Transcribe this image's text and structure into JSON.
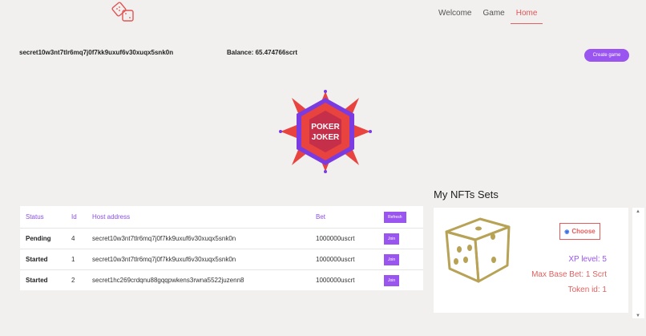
{
  "nav": {
    "tabs": [
      {
        "label": "Welcome"
      },
      {
        "label": "Game"
      },
      {
        "label": "Home"
      }
    ],
    "active": "Home"
  },
  "account": {
    "address": "secret10w3nt7tlr6mq7j0f7kk9uxuf6v30xuqx5snk0n",
    "balance": "Balance: 65.474766scrt"
  },
  "actions": {
    "create_game": "Create game",
    "refresh": "Refresh",
    "join": "Join"
  },
  "banner": {
    "line1": "POKER",
    "line2": "JOKER"
  },
  "games_table": {
    "columns": [
      "Status",
      "Id",
      "Host address",
      "Bet"
    ],
    "rows": [
      {
        "status": "Pending",
        "id": "4",
        "host": "secret10w3nt7tlr6mq7j0f7kk9uxuf6v30xuqx5snk0n",
        "bet": "1000000uscrt"
      },
      {
        "status": "Started",
        "id": "1",
        "host": "secret10w3nt7tlr6mq7j0f7kk9uxuf6v30xuqx5snk0n",
        "bet": "1000000uscrt"
      },
      {
        "status": "Started",
        "id": "2",
        "host": "secret1hc269crdqnu88gqqpwkens3rwna5522juzenn8",
        "bet": "1000000uscrt"
      }
    ]
  },
  "nfts": {
    "title": "My NFTs Sets",
    "choose_label": "Choose",
    "xp": "XP level: 5",
    "max_bet": "Max Base Bet: 1 Scrt",
    "token_id": "Token id: 1"
  },
  "colors": {
    "accent": "#9a55f0",
    "active_tab": "#e05555",
    "dice": "#b7a255"
  }
}
